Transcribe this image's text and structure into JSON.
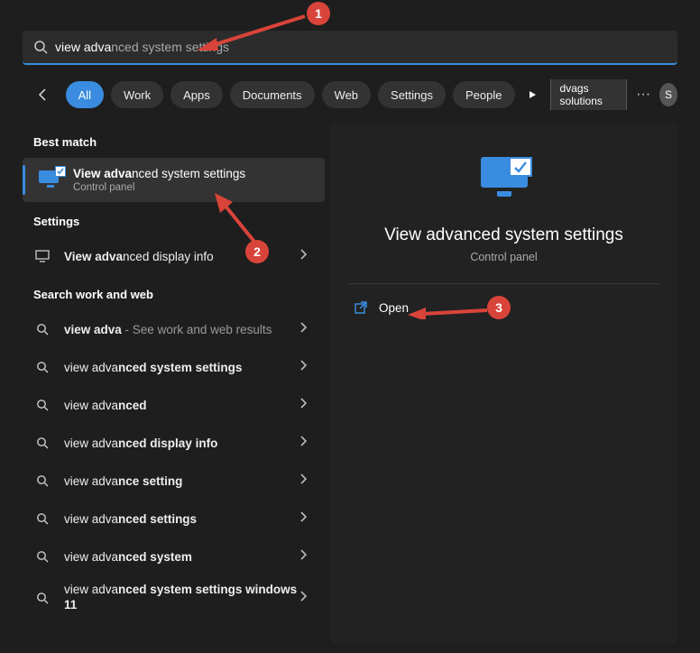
{
  "search": {
    "typed": "view adva",
    "suggestion_rest": "nced system settings"
  },
  "filters": {
    "items": [
      "All",
      "Work",
      "Apps",
      "Documents",
      "Web",
      "Settings",
      "People"
    ],
    "active_index": 0
  },
  "right_header": {
    "chip": "dvags solutions",
    "avatar_initial": "S"
  },
  "left": {
    "best_match_label": "Best match",
    "best_match": {
      "title_bold": "View adva",
      "title_rest": "nced system settings",
      "subtitle": "Control panel"
    },
    "settings_label": "Settings",
    "settings_item": {
      "bold": "View adva",
      "rest": "nced display info"
    },
    "work_web_label": "Search work and web",
    "work_web_items": [
      {
        "pre": "",
        "bold": "view adva",
        "rest": "",
        "sub": " - See work and web results"
      },
      {
        "pre": "view adva",
        "bold": "nced system settings",
        "rest": "",
        "sub": ""
      },
      {
        "pre": "view adva",
        "bold": "nced",
        "rest": "",
        "sub": ""
      },
      {
        "pre": "view adva",
        "bold": "nced display info",
        "rest": "",
        "sub": ""
      },
      {
        "pre": "view adva",
        "bold": "nce setting",
        "rest": "",
        "sub": ""
      },
      {
        "pre": "view adva",
        "bold": "nced settings",
        "rest": "",
        "sub": ""
      },
      {
        "pre": "view adva",
        "bold": "nced system",
        "rest": "",
        "sub": ""
      },
      {
        "pre": "view adva",
        "bold": "nced system settings windows 11",
        "rest": "",
        "sub": ""
      }
    ]
  },
  "right": {
    "title": "View advanced system settings",
    "subtitle": "Control panel",
    "open_label": "Open"
  },
  "callouts": {
    "c1": "1",
    "c2": "2",
    "c3": "3"
  }
}
